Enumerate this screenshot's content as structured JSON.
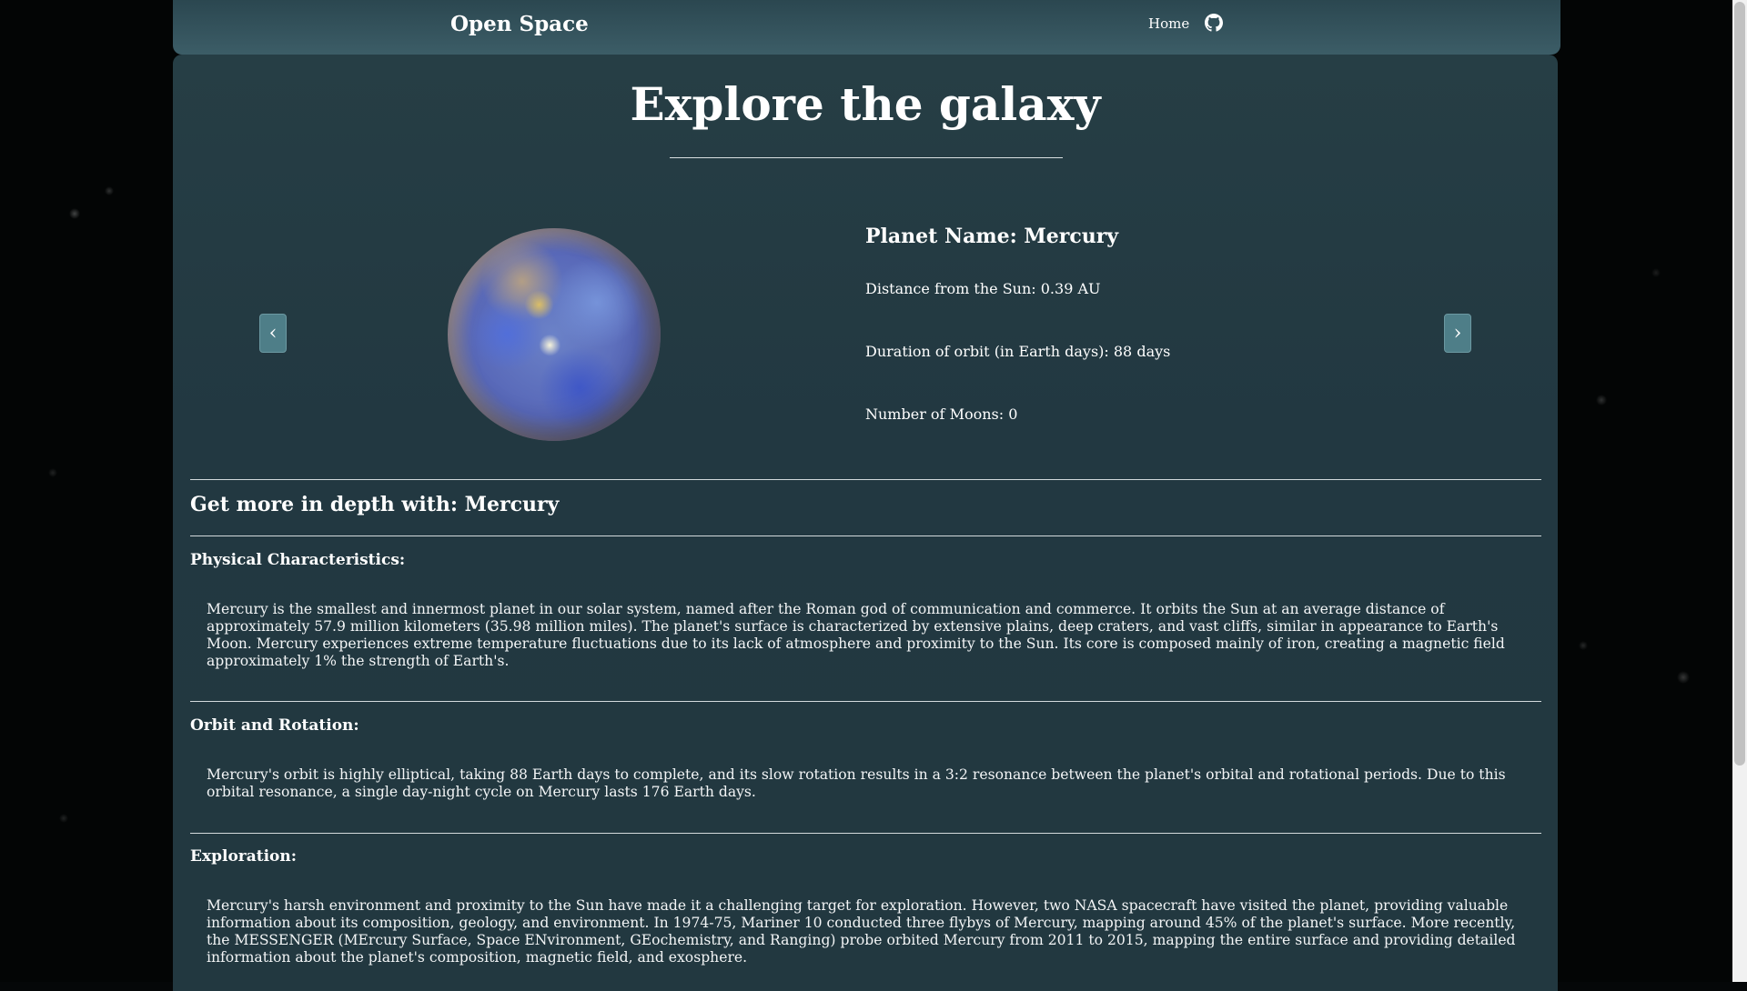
{
  "navbar": {
    "brand": "Open Space",
    "home_label": "Home",
    "github_icon": "github-icon"
  },
  "hero": {
    "title": "Explore the galaxy"
  },
  "carousel": {
    "prev_icon": "chevron-left-icon",
    "next_icon": "chevron-right-icon",
    "prev_glyph": "‹",
    "next_glyph": "›",
    "planet": {
      "name": "Planet Name: Mercury",
      "distance": "Distance from the Sun: 0.39 AU",
      "orbit": "Duration of orbit (in Earth days): 88 days",
      "moons": "Number of Moons: 0"
    }
  },
  "details": {
    "heading": "Get more in depth with: Mercury",
    "sections": [
      {
        "title": "Physical Characteristics:",
        "text": "Mercury is the smallest and innermost planet in our solar system, named after the Roman god of communication and commerce. It orbits the Sun at an average distance of approximately 57.9 million kilometers (35.98 million miles). The planet's surface is characterized by extensive plains, deep craters, and vast cliffs, similar in appearance to Earth's Moon. Mercury experiences extreme temperature fluctuations due to its lack of atmosphere and proximity to the Sun. Its core is composed mainly of iron, creating a magnetic field approximately 1% the strength of Earth's."
      },
      {
        "title": "Orbit and Rotation:",
        "text": "Mercury's orbit is highly elliptical, taking 88 Earth days to complete, and its slow rotation results in a 3:2 resonance between the planet's orbital and rotational periods. Due to this orbital resonance, a single day-night cycle on Mercury lasts 176 Earth days."
      },
      {
        "title": "Exploration:",
        "text": "Mercury's harsh environment and proximity to the Sun have made it a challenging target for exploration. However, two NASA spacecraft have visited the planet, providing valuable information about its composition, geology, and environment. In 1974-75, Mariner 10 conducted three flybys of Mercury, mapping around 45% of the planet's surface. More recently, the MESSENGER (MErcury Surface, Space ENvironment, GEochemistry, and Ranging) probe orbited Mercury from 2011 to 2015, mapping the entire surface and providing detailed information about the planet's composition, magnetic field, and exosphere."
      }
    ]
  },
  "colors": {
    "navbar_bg": "#3c5d67",
    "panel_bg": "#223840",
    "button_bg": "#4e7e88",
    "text": "#ffffff"
  }
}
